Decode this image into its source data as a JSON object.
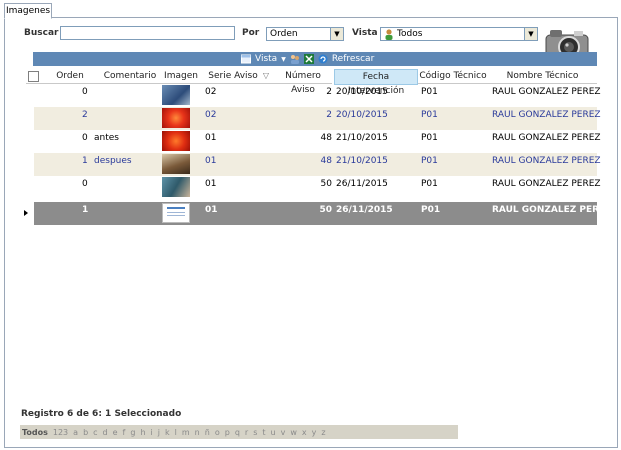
{
  "tab": {
    "label": "Imagenes"
  },
  "filters": {
    "search_label": "Buscar",
    "search_value": "",
    "por_label": "Por",
    "por_value": "Orden",
    "vista_label": "Vista",
    "vista_value": "Todos"
  },
  "toolbar": {
    "vista_label": "Vista",
    "refresh_label": "Refrescar"
  },
  "columns": [
    "Orden",
    "Comentario",
    "Imagen",
    "Serie Aviso",
    "Número Aviso",
    "Fecha Intervención",
    "Código Técnico",
    "Nombre Técnico"
  ],
  "rows": [
    {
      "orden": "0",
      "comentario": "",
      "serie": "02",
      "numero": "2",
      "fecha": "20/10/2015",
      "codigo": "P01",
      "nombre": "RAUL GONZALEZ PEREZ",
      "thumb": "blue"
    },
    {
      "orden": "2",
      "comentario": "",
      "serie": "02",
      "numero": "2",
      "fecha": "20/10/2015",
      "codigo": "P01",
      "nombre": "RAUL GONZALEZ PEREZ",
      "thumb": "red"
    },
    {
      "orden": "0",
      "comentario": "antes",
      "serie": "01",
      "numero": "48",
      "fecha": "21/10/2015",
      "codigo": "P01",
      "nombre": "RAUL GONZALEZ PEREZ",
      "thumb": "red"
    },
    {
      "orden": "1",
      "comentario": "despues",
      "serie": "01",
      "numero": "48",
      "fecha": "21/10/2015",
      "codigo": "P01",
      "nombre": "RAUL GONZALEZ PEREZ",
      "thumb": "brown"
    },
    {
      "orden": "0",
      "comentario": "",
      "serie": "01",
      "numero": "50",
      "fecha": "26/11/2015",
      "codigo": "P01",
      "nombre": "RAUL GONZALEZ PEREZ",
      "thumb": "teal"
    },
    {
      "orden": "1",
      "comentario": "",
      "serie": "01",
      "numero": "50",
      "fecha": "26/11/2015",
      "codigo": "P01",
      "nombre": "RAUL GONZALEZ PEREZ",
      "thumb": "doc"
    }
  ],
  "status": "Registro 6 de 6: 1 Seleccionado",
  "alphabet": [
    "Todos",
    "123",
    "a",
    "b",
    "c",
    "d",
    "e",
    "f",
    "g",
    "h",
    "i",
    "j",
    "k",
    "l",
    "m",
    "n",
    "ñ",
    "o",
    "p",
    "q",
    "r",
    "s",
    "t",
    "u",
    "v",
    "w",
    "x",
    "y",
    "z"
  ],
  "icons": {
    "camera": "camera-icon",
    "user": "user-icon",
    "excel": "excel-icon",
    "refresh": "refresh-icon",
    "view": "view-icon",
    "users": "users-icon"
  },
  "colors": {
    "toolbar": "#5f88b5",
    "alt_row": "#f1ede0",
    "selected_row": "#8c8c8c",
    "link_text": "#2a3a9a",
    "sorted_header": "#cfe8f7"
  }
}
